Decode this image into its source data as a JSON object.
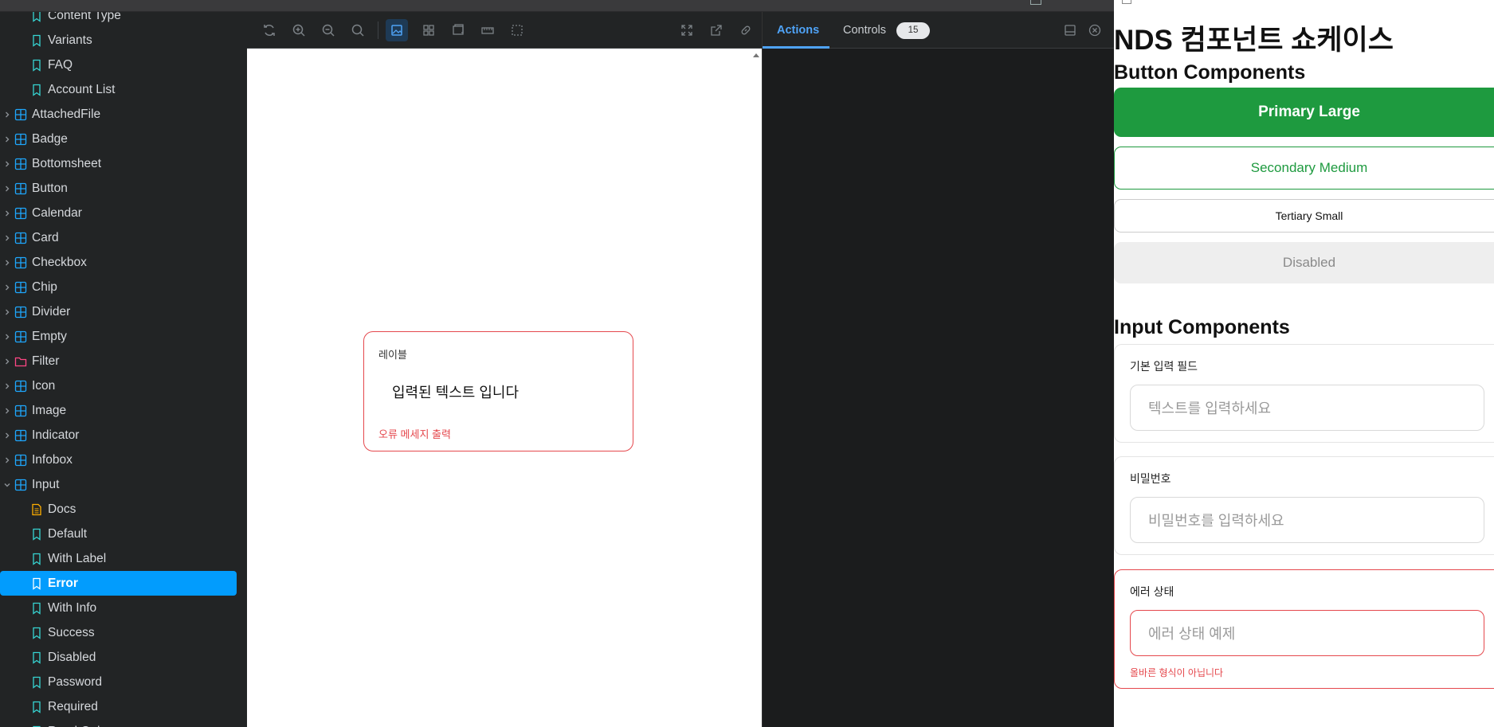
{
  "sidebar": {
    "items": [
      {
        "label": "Content Type",
        "kind": "story"
      },
      {
        "label": "Variants",
        "kind": "story"
      },
      {
        "label": "FAQ",
        "kind": "story"
      },
      {
        "label": "Account List",
        "kind": "story"
      },
      {
        "label": "AttachedFile",
        "kind": "component"
      },
      {
        "label": "Badge",
        "kind": "component"
      },
      {
        "label": "Bottomsheet",
        "kind": "component"
      },
      {
        "label": "Button",
        "kind": "component"
      },
      {
        "label": "Calendar",
        "kind": "component"
      },
      {
        "label": "Card",
        "kind": "component"
      },
      {
        "label": "Checkbox",
        "kind": "component"
      },
      {
        "label": "Chip",
        "kind": "component"
      },
      {
        "label": "Divider",
        "kind": "component"
      },
      {
        "label": "Empty",
        "kind": "component"
      },
      {
        "label": "Filter",
        "kind": "folder"
      },
      {
        "label": "Icon",
        "kind": "component"
      },
      {
        "label": "Image",
        "kind": "component"
      },
      {
        "label": "Indicator",
        "kind": "component"
      },
      {
        "label": "Infobox",
        "kind": "component"
      },
      {
        "label": "Input",
        "kind": "component-open"
      },
      {
        "label": "Docs",
        "kind": "docs"
      },
      {
        "label": "Default",
        "kind": "story"
      },
      {
        "label": "With Label",
        "kind": "story"
      },
      {
        "label": "Error",
        "kind": "story-selected"
      },
      {
        "label": "With Info",
        "kind": "story"
      },
      {
        "label": "Success",
        "kind": "story"
      },
      {
        "label": "Disabled",
        "kind": "story"
      },
      {
        "label": "Password",
        "kind": "story"
      },
      {
        "label": "Required",
        "kind": "story"
      },
      {
        "label": "Read Only",
        "kind": "story"
      }
    ]
  },
  "colors": {
    "accent": "#029cfd",
    "story_icon": "#37d5d3",
    "component_icon": "#1ea7fd",
    "folder_icon": "#ff4785",
    "docs_icon": "#ffae00",
    "success_green": "#1e9a3f",
    "error_red": "#e5484d"
  },
  "toolbar": {
    "icons": [
      "sync-icon",
      "zoom-in-icon",
      "zoom-out-icon",
      "zoom-reset-icon",
      "background-icon",
      "grid-icon",
      "viewport-icon",
      "measure-icon",
      "outline-icon",
      "fullscreen-icon",
      "open-new-tab-icon",
      "copy-link-icon"
    ]
  },
  "preview": {
    "label": "레이블",
    "value": "입력된 텍스트 입니다",
    "error": "오류 메세지 출력"
  },
  "addons": {
    "tab_actions": "Actions",
    "tab_controls": "Controls",
    "controls_count": "15"
  },
  "showcase": {
    "title": "NDS 컴포넌트 쇼케이스",
    "buttons_heading": "Button Components",
    "btn_primary": "Primary Large",
    "btn_secondary": "Secondary Medium",
    "btn_tertiary": "Tertiary Small",
    "btn_disabled": "Disabled",
    "inputs_heading": "Input Components",
    "field1_label": "기본 입력 필드",
    "field1_placeholder": "텍스트를 입력하세요",
    "field2_label": "비밀번호",
    "field2_placeholder": "비밀번호를 입력하세요",
    "field3_label": "에러 상태",
    "field3_placeholder": "에러 상태 예제",
    "field3_error": "올바른 형식이 아닙니다"
  }
}
